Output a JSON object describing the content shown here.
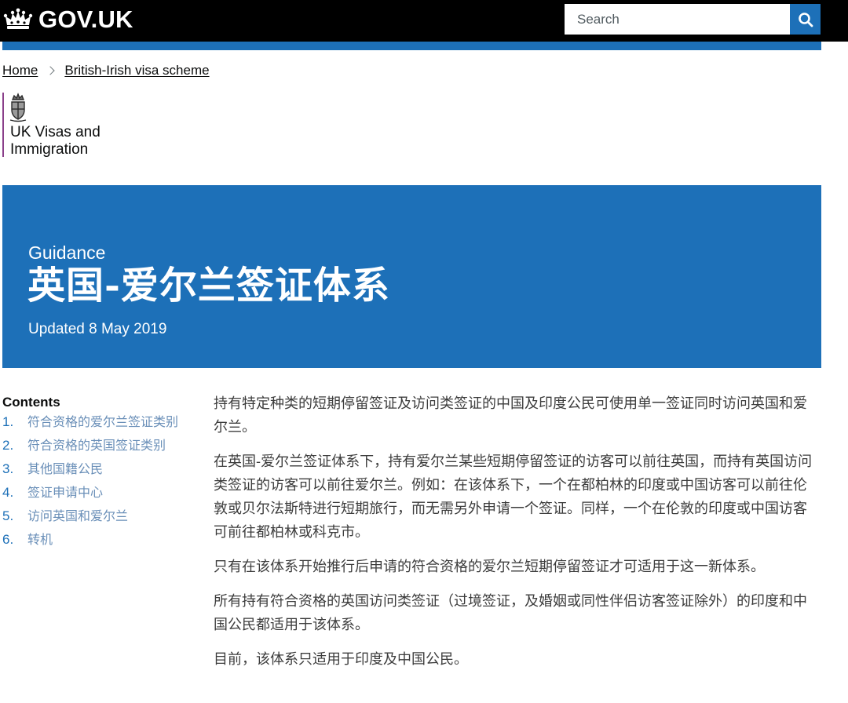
{
  "header": {
    "logo_text": "GOV.UK",
    "search": {
      "placeholder": "Search"
    }
  },
  "breadcrumb": [
    "Home",
    "British-Irish visa scheme"
  ],
  "organisation": {
    "line1": "UK Visas and",
    "line2": "Immigration",
    "accent": "#8a3f8a"
  },
  "hero": {
    "kicker": "Guidance",
    "title": "英国-爱尔兰签证体系",
    "updated": "Updated 8 May 2019",
    "background": "#1d70b8"
  },
  "contents": {
    "title": "Contents",
    "items": [
      {
        "num": "1.",
        "label": "符合资格的爱尔兰签证类别"
      },
      {
        "num": "2.",
        "label": "符合资格的英国签证类别"
      },
      {
        "num": "3.",
        "label": "其他国籍公民"
      },
      {
        "num": "4.",
        "label": "签证申请中心"
      },
      {
        "num": "5.",
        "label": "访问英国和爱尔兰"
      },
      {
        "num": "6.",
        "label": "转机"
      }
    ]
  },
  "body": {
    "paragraphs": [
      "持有特定种类的短期停留签证及访问类签证的中国及印度公民可使用单一签证同时访问英国和爱尔兰。",
      "在英国-爱尔兰签证体系下，持有爱尔兰某些短期停留签证的访客可以前往英国，而持有英国访问类签证的访客可以前往爱尔兰。例如：在该体系下，一个在都柏林的印度或中国访客可以前往伦敦或贝尔法斯特进行短期旅行，而无需另外申请一个签证。同样，一个在伦敦的印度或中国访客可前往都柏林或科克市。",
      "只有在该体系开始推行后申请的符合资格的爱尔兰短期停留签证才可适用于这一新体系。",
      "所有持有符合资格的英国访问类签证（过境签证，及婚姻或同性伴侣访客签证除外）的印度和中国公民都适用于该体系。",
      "目前，该体系只适用于印度及中国公民。"
    ]
  },
  "colors": {
    "header_bg": "#000000",
    "brand_blue": "#1d70b8"
  }
}
